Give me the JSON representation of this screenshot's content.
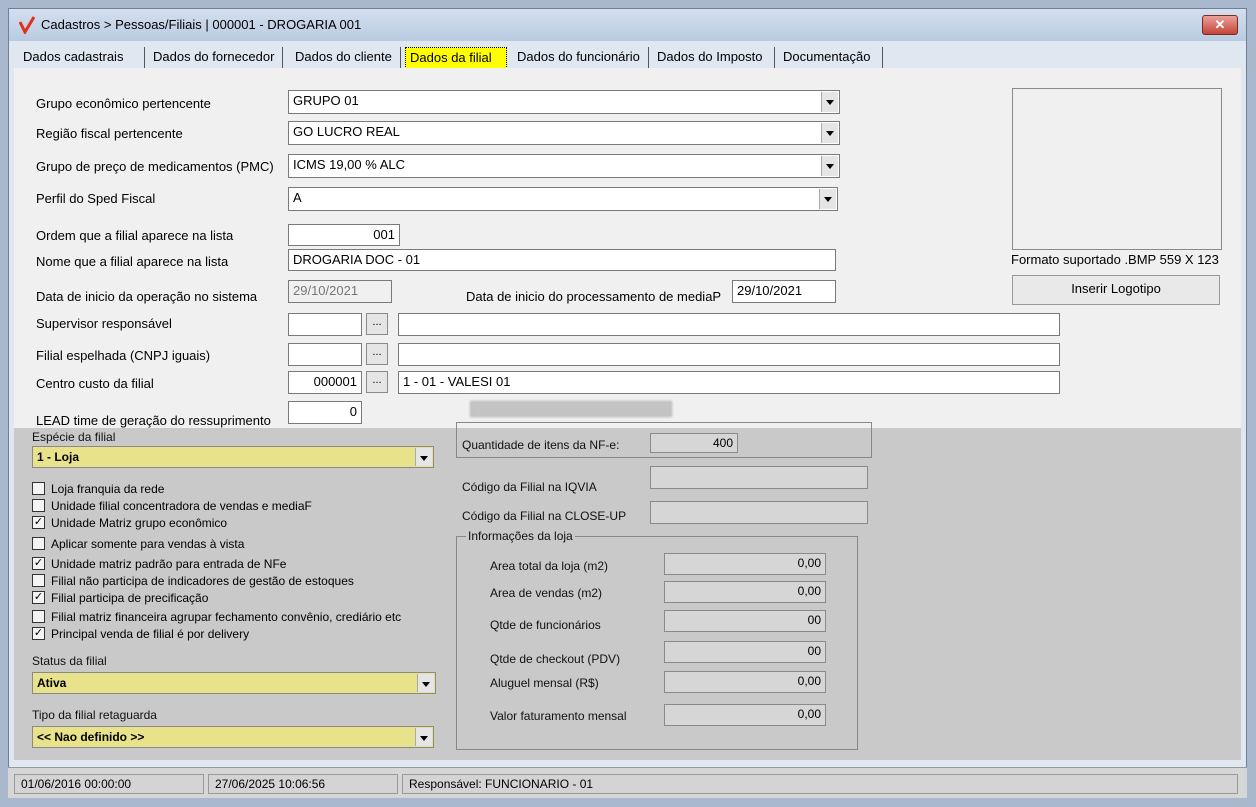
{
  "window": {
    "title": "Cadastros > Pessoas/Filiais | 000001 - DROGARIA 001",
    "close_label": "✕"
  },
  "tabs": [
    {
      "label": "Dados cadastrais"
    },
    {
      "label": "Dados do fornecedor"
    },
    {
      "label": "Dados do cliente"
    },
    {
      "label": "Dados da filial"
    },
    {
      "label": "Dados do funcionário"
    },
    {
      "label": "Dados do Imposto"
    },
    {
      "label": "Documentação"
    }
  ],
  "form": {
    "grupo_economico": {
      "label": "Grupo econômico pertencente",
      "value": "GRUPO 01"
    },
    "regiao_fiscal": {
      "label": "Região fiscal pertencente",
      "value": "GO LUCRO REAL"
    },
    "grupo_preco": {
      "label": "Grupo de preço de medicamentos (PMC)",
      "value": "ICMS 19,00 % ALC"
    },
    "perfil_sped": {
      "label": "Perfil do Sped Fiscal",
      "value": "A"
    },
    "ordem": {
      "label": "Ordem que a filial aparece na lista",
      "value": "001"
    },
    "nome": {
      "label": "Nome que a filial aparece na lista",
      "value": "DROGARIA DOC - 01"
    },
    "data_inicio": {
      "label": "Data de inicio da operação no sistema",
      "value": "29/10/2021"
    },
    "data_processamento": {
      "label": "Data de inicio do processamento de mediaP",
      "value": "29/10/2021"
    },
    "supervisor": {
      "label": "Supervisor responsável",
      "code": "",
      "name": ""
    },
    "filial_espelhada": {
      "label": "Filial espelhada (CNPJ iguais)",
      "code": "",
      "name": ""
    },
    "centro_custo": {
      "label": "Centro custo da filial",
      "code": "000001",
      "name": "1 - 01 - VALESI 01"
    },
    "lead_time": {
      "label": "LEAD time de geração do ressuprimento",
      "value": "0"
    },
    "dots_label": "..."
  },
  "logo": {
    "format_label": "Formato suportado .BMP 559 X 123",
    "insert_button": "Inserir Logotipo"
  },
  "lower": {
    "especie": {
      "label": "Espécie da filial",
      "value": "1 - Loja"
    },
    "checkboxes": [
      {
        "label": "Loja franquia da rede",
        "checked": false
      },
      {
        "label": "Unidade filial concentradora de vendas e mediaF",
        "checked": false
      },
      {
        "label": "Unidade Matriz grupo econômico",
        "checked": true
      },
      {
        "label": "Aplicar somente para vendas à vista",
        "checked": false
      },
      {
        "label": "Unidade matriz padrão para entrada de NFe",
        "checked": true
      },
      {
        "label": "Filial não participa de indicadores de gestão de estoques",
        "checked": false
      },
      {
        "label": "Filial participa de precificação",
        "checked": true
      },
      {
        "label": "Filial matriz financeira agrupar fechamento convênio, crediário etc",
        "checked": false
      },
      {
        "label": "Principal venda de filial é por delivery",
        "checked": true
      }
    ],
    "status": {
      "label": "Status da filial",
      "value": "Ativa"
    },
    "tipo": {
      "label": "Tipo da filial retaguarda",
      "value": "<< Nao definido >>"
    },
    "qtd_itens": {
      "label": "Quantidade de itens da NF-e:",
      "value": "400"
    },
    "iqvia": {
      "label": "Código da Filial na IQVIA",
      "value": ""
    },
    "closeup": {
      "label": "Código da Filial na CLOSE-UP",
      "value": ""
    },
    "info_loja": {
      "title": "Informações da loja",
      "fields": [
        {
          "label": "Area total da loja (m2)",
          "value": "0,00"
        },
        {
          "label": "Area de vendas (m2)",
          "value": "0,00"
        },
        {
          "label": "Qtde de funcionários",
          "value": "00"
        },
        {
          "label": "Qtde de checkout (PDV)",
          "value": "00"
        },
        {
          "label": "Aluguel mensal (R$)",
          "value": "0,00"
        },
        {
          "label": "Valor faturamento mensal",
          "value": "0,00"
        }
      ]
    }
  },
  "statusbar": {
    "created": "01/06/2016 00:00:00",
    "updated": "27/06/2025 10:06:56",
    "responsavel": "Responsável: FUNCIONARIO - 01"
  }
}
